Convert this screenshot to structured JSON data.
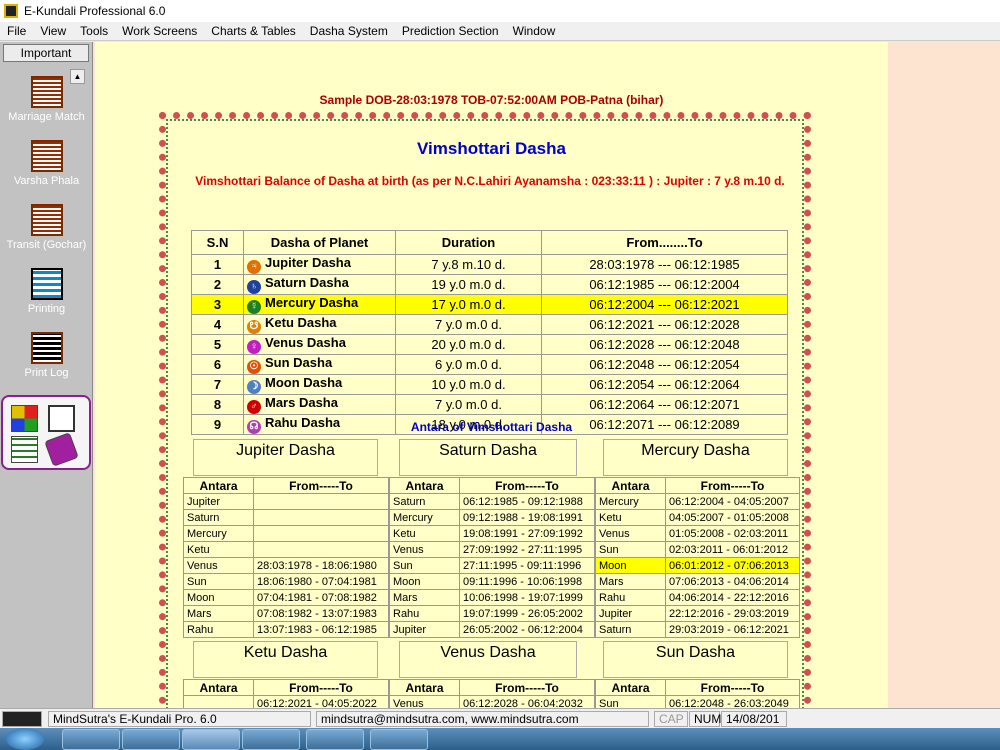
{
  "window": {
    "title": "E-Kundali Professional 6.0"
  },
  "menu": [
    "File",
    "View",
    "Tools",
    "Work Screens",
    "Charts & Tables",
    "Dasha System",
    "Prediction Section",
    "Window"
  ],
  "sidebar": {
    "header": "Important",
    "items": [
      "Marriage Match",
      "Varsha Phala",
      "Transit (Gochar)",
      "Printing",
      "Print Log"
    ]
  },
  "sample": "Sample DOB-28:03:1978 TOB-07:52:00AM POB-Patna (bihar)",
  "title": "Vimshottari Dasha",
  "balance": "Vimshottari Balance of Dasha at birth (as per N.C.Lahiri Ayanamsha : 023:33:11 ) : Jupiter  :  7 y.8 m.10 d.",
  "dasha_headers": [
    "S.N",
    "Dasha of Planet",
    "Duration",
    "From........To"
  ],
  "dasha_rows": [
    {
      "sn": "1",
      "planet": "Jupiter Dasha",
      "dur": "7 y.8 m.10 d.",
      "period": "28:03:1978 --- 06:12:1985",
      "sym": "♃",
      "color": "#e07000"
    },
    {
      "sn": "2",
      "planet": "Saturn Dasha",
      "dur": "19 y.0 m.0 d.",
      "period": "06:12:1985 --- 06:12:2004",
      "sym": "♄",
      "color": "#2040a0"
    },
    {
      "sn": "3",
      "planet": "Mercury Dasha",
      "dur": "17 y.0 m.0 d.",
      "period": "06:12:2004 --- 06:12:2021",
      "sym": "☿",
      "color": "#208020",
      "hl": true
    },
    {
      "sn": "4",
      "planet": "Ketu Dasha",
      "dur": "7 y.0 m.0 d.",
      "period": "06:12:2021 --- 06:12:2028",
      "sym": "☋",
      "color": "#e08000"
    },
    {
      "sn": "5",
      "planet": "Venus Dasha",
      "dur": "20 y.0 m.0 d.",
      "period": "06:12:2028 --- 06:12:2048",
      "sym": "♀",
      "color": "#c020c0"
    },
    {
      "sn": "6",
      "planet": "Sun Dasha",
      "dur": "6 y.0 m.0 d.",
      "period": "06:12:2048 --- 06:12:2054",
      "sym": "☉",
      "color": "#e05000"
    },
    {
      "sn": "7",
      "planet": "Moon Dasha",
      "dur": "10 y.0 m.0 d.",
      "period": "06:12:2054 --- 06:12:2064",
      "sym": "☽",
      "color": "#5080c0"
    },
    {
      "sn": "8",
      "planet": "Mars Dasha",
      "dur": "7 y.0 m.0 d.",
      "period": "06:12:2064 --- 06:12:2071",
      "sym": "♂",
      "color": "#d00000"
    },
    {
      "sn": "9",
      "planet": "Rahu Dasha",
      "dur": "18 y.0 m.0 d.",
      "period": "06:12:2071 --- 06:12:2089",
      "sym": "☊",
      "color": "#b040b0"
    }
  ],
  "antara_title": "Antara of Vimshottari Dasha",
  "antara_headers": [
    "Antara",
    "From-----To"
  ],
  "antara": [
    {
      "name": "Jupiter Dasha",
      "rows": [
        [
          "Jupiter",
          ""
        ],
        [
          "Saturn",
          ""
        ],
        [
          "Mercury",
          ""
        ],
        [
          "Ketu",
          ""
        ],
        [
          "Venus",
          "28:03:1978 - 18:06:1980"
        ],
        [
          "Sun",
          "18:06:1980 - 07:04:1981"
        ],
        [
          "Moon",
          "07:04:1981 - 07:08:1982"
        ],
        [
          "Mars",
          "07:08:1982 - 13:07:1983"
        ],
        [
          "Rahu",
          "13:07:1983 - 06:12:1985"
        ]
      ]
    },
    {
      "name": "Saturn Dasha",
      "rows": [
        [
          "Saturn",
          "06:12:1985 - 09:12:1988"
        ],
        [
          "Mercury",
          "09:12:1988 - 19:08:1991"
        ],
        [
          "Ketu",
          "19:08:1991 - 27:09:1992"
        ],
        [
          "Venus",
          "27:09:1992 - 27:11:1995"
        ],
        [
          "Sun",
          "27:11:1995 - 09:11:1996"
        ],
        [
          "Moon",
          "09:11:1996 - 10:06:1998"
        ],
        [
          "Mars",
          "10:06:1998 - 19:07:1999"
        ],
        [
          "Rahu",
          "19:07:1999 - 26:05:2002"
        ],
        [
          "Jupiter",
          "26:05:2002 - 06:12:2004"
        ]
      ]
    },
    {
      "name": "Mercury Dasha",
      "rows": [
        [
          "Mercury",
          "06:12:2004 - 04:05:2007"
        ],
        [
          "Ketu",
          "04:05:2007 - 01:05:2008"
        ],
        [
          "Venus",
          "01:05:2008 - 02:03:2011"
        ],
        [
          "Sun",
          "02:03:2011 - 06:01:2012"
        ],
        [
          "Moon",
          "06:01:2012 - 07:06:2013"
        ],
        [
          "Mars",
          "07:06:2013 - 04:06:2014"
        ],
        [
          "Rahu",
          "04:06:2014 - 22:12:2016"
        ],
        [
          "Jupiter",
          "22:12:2016 - 29:03:2019"
        ],
        [
          "Saturn",
          "29:03:2019 - 06:12:2021"
        ]
      ],
      "hl": 4
    },
    {
      "name": "Ketu Dasha",
      "rows": [
        [
          "",
          "06:12:2021 - 04:05:2022"
        ]
      ]
    },
    {
      "name": "Venus Dasha",
      "rows": [
        [
          "Venus",
          "06:12:2028 - 06:04:2032"
        ]
      ]
    },
    {
      "name": "Sun Dasha",
      "rows": [
        [
          "Sun",
          "06:12:2048 - 26:03:2049"
        ]
      ]
    }
  ],
  "status": {
    "app": "MindSutra's E-Kundali Pro. 6.0",
    "site": "mindsutra@mindsutra.com, www.mindsutra.com",
    "cap": "CAP",
    "num": "NUM",
    "date": "14/08/201"
  }
}
